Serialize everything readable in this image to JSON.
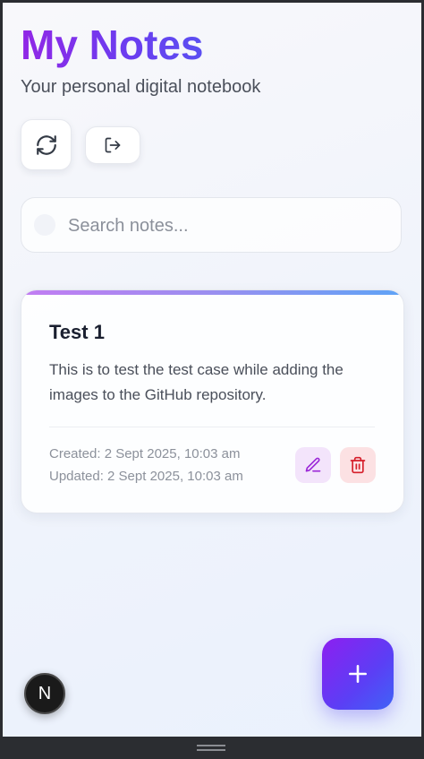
{
  "header": {
    "title": "My Notes",
    "subtitle": "Your personal digital notebook"
  },
  "toolbar": {
    "refresh_icon": "refresh-icon",
    "logout_icon": "logout-icon"
  },
  "search": {
    "placeholder": "Search notes...",
    "value": ""
  },
  "notes": [
    {
      "title": "Test 1",
      "body": "This is to test the test case while adding the images to the GitHub repository.",
      "created": "Created: 2 Sept 2025, 10:03 am",
      "updated": "Updated: 2 Sept 2025, 10:03 am",
      "edit_icon": "pencil-icon",
      "delete_icon": "trash-icon"
    }
  ],
  "fab": {
    "icon": "plus-icon"
  },
  "nextjs_badge": {
    "label": "N"
  },
  "colors": {
    "accent_purple": "#8d1ff0",
    "accent_blue": "#3f63f7",
    "edit_color": "#9b27d8",
    "delete_color": "#d61f2b"
  }
}
